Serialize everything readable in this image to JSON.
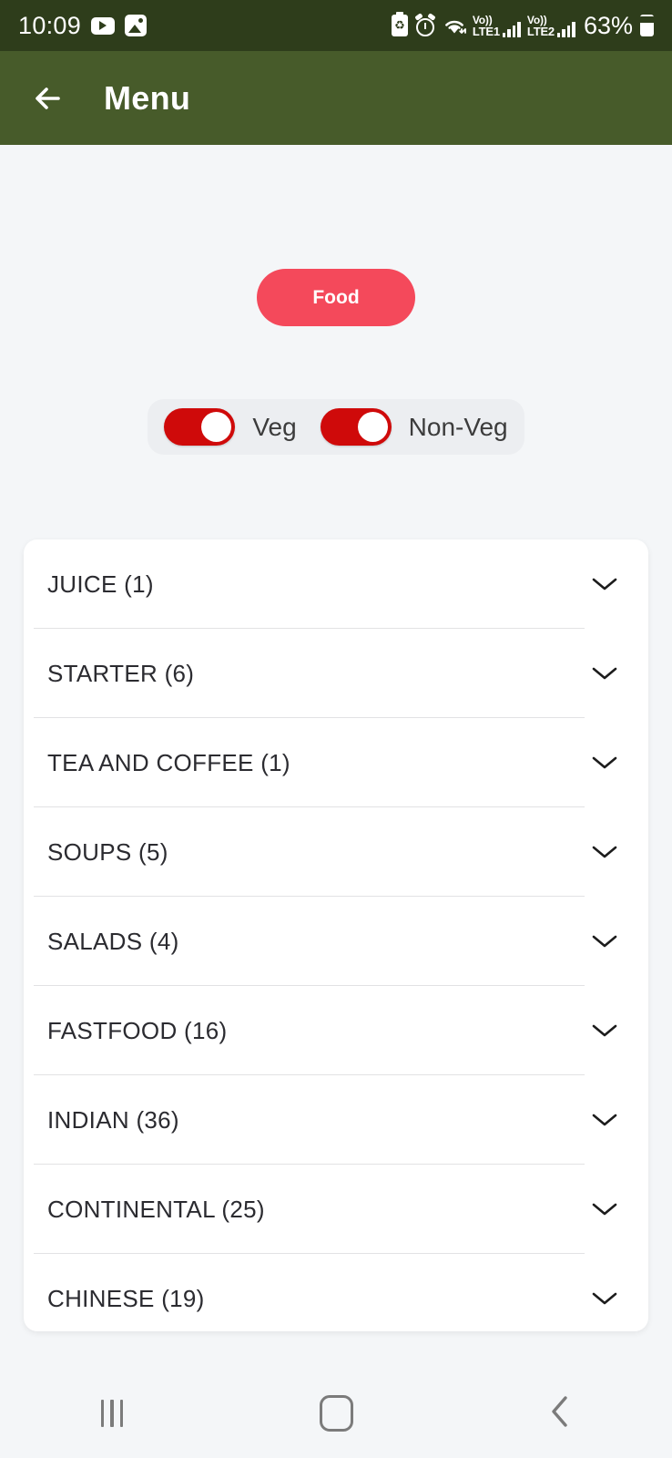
{
  "status_bar": {
    "time": "10:09",
    "battery_percent": "63%",
    "network_1": {
      "volte": "Vo))",
      "tech": "LTE1"
    },
    "network_2": {
      "volte": "Vo))",
      "tech": "LTE2"
    },
    "icons": [
      "youtube-icon",
      "gallery-icon",
      "battery-saver-icon",
      "alarm-icon",
      "wifi-icon",
      "battery-icon"
    ],
    "background_color": "#2e3d1b"
  },
  "app_bar": {
    "title": "Menu",
    "back_label": "Back",
    "background_color": "#475b2a",
    "text_color": "#ffffff"
  },
  "chip": {
    "label": "Food",
    "color": "#f4495b",
    "text_color": "#ffffff"
  },
  "filters": {
    "toggles": [
      {
        "label": "Veg",
        "state": "on",
        "color": "#cf0a0a"
      },
      {
        "label": "Non-Veg",
        "state": "on",
        "color": "#cf0a0a"
      }
    ],
    "background_color": "#eceef1"
  },
  "categories": [
    {
      "label": "JUICE (1)",
      "name": "JUICE",
      "count": 1,
      "expanded": false
    },
    {
      "label": "STARTER (6)",
      "name": "STARTER",
      "count": 6,
      "expanded": false
    },
    {
      "label": "TEA AND COFFEE (1)",
      "name": "TEA AND COFFEE",
      "count": 1,
      "expanded": false
    },
    {
      "label": "SOUPS (5)",
      "name": "SOUPS",
      "count": 5,
      "expanded": false
    },
    {
      "label": "SALADS (4)",
      "name": "SALADS",
      "count": 4,
      "expanded": false
    },
    {
      "label": "FASTFOOD (16)",
      "name": "FASTFOOD",
      "count": 16,
      "expanded": false
    },
    {
      "label": "INDIAN (36)",
      "name": "INDIAN",
      "count": 36,
      "expanded": false
    },
    {
      "label": "CONTINENTAL (25)",
      "name": "CONTINENTAL",
      "count": 25,
      "expanded": false
    },
    {
      "label": "CHINESE (19)",
      "name": "CHINESE",
      "count": 19,
      "expanded": false
    }
  ],
  "nav_bar": {
    "recents_label": "Recents",
    "home_label": "Home",
    "back_label": "Back"
  },
  "theme": {
    "page_background": "#f4f6f8",
    "card_background": "#ffffff",
    "text_primary": "#2b2b30",
    "divider": "#e2e2e4"
  }
}
